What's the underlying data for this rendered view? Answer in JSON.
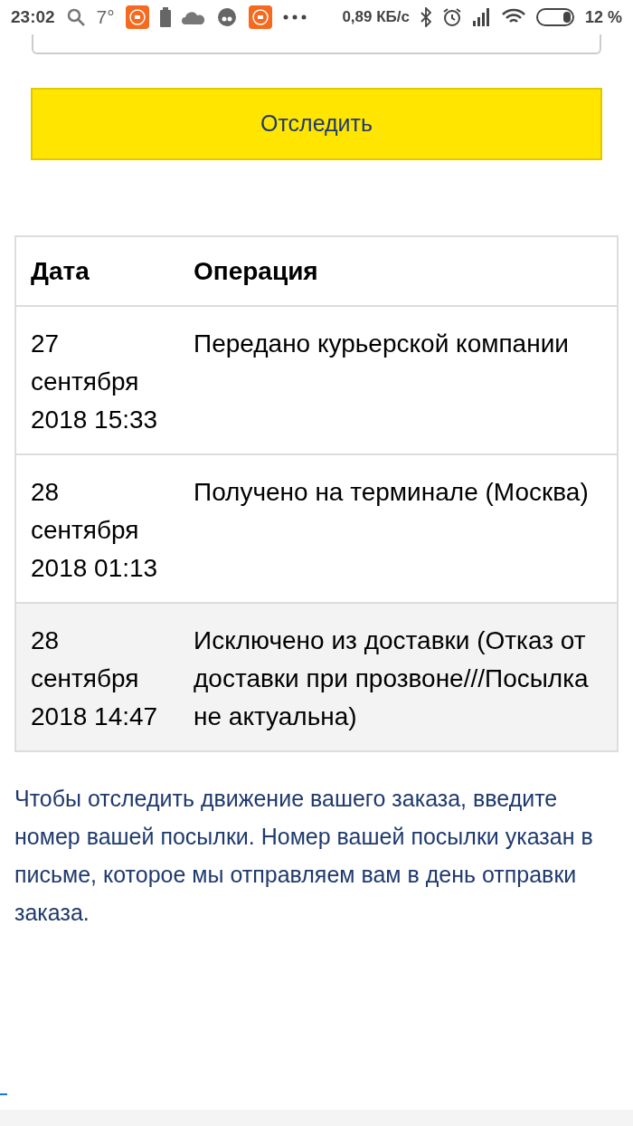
{
  "status_bar": {
    "time": "23:02",
    "temperature": "7°",
    "network_speed": "0,89 КБ/с",
    "battery": "12 %"
  },
  "track_button": {
    "label": "Отследить"
  },
  "table": {
    "columns": [
      "Дата",
      "Операция"
    ],
    "rows": [
      {
        "date": "27 сентября 2018 15:33",
        "operation": "Передано курьерской компании",
        "highlighted": false
      },
      {
        "date": "28 сентября 2018 01:13",
        "operation": "Получено на терминале (Москва)",
        "highlighted": false
      },
      {
        "date": "28 сентября 2018 14:47",
        "operation": "Исключено из доставки (Отказ от доставки при прозвоне///Посылка не актуальна)",
        "highlighted": true
      }
    ]
  },
  "hint": "Чтобы отследить движение вашего заказа, введите номер вашей посылки. Номер вашей посылки указан в письме, которое мы отправляем вам в день отправки заказа."
}
